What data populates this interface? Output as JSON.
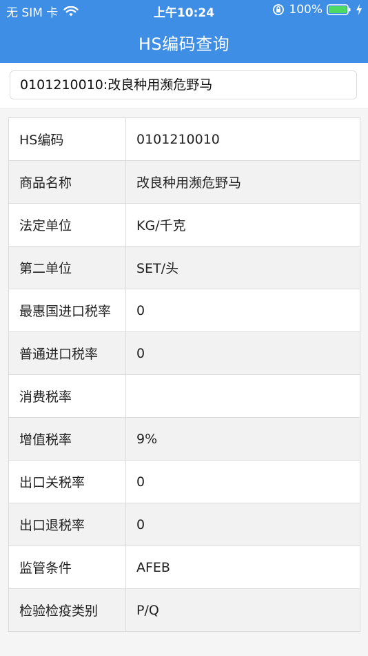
{
  "status_bar": {
    "carrier": "无 SIM 卡",
    "time": "上午10:24",
    "battery": "100%"
  },
  "header": {
    "title": "HS编码查询"
  },
  "search": {
    "value": "0101210010:改良种用濒危野马"
  },
  "table": {
    "rows": [
      {
        "label": "HS编码",
        "value": "0101210010"
      },
      {
        "label": "商品名称",
        "value": "改良种用濒危野马"
      },
      {
        "label": "法定单位",
        "value": "KG/千克"
      },
      {
        "label": "第二单位",
        "value": "SET/头"
      },
      {
        "label": "最惠国进口税率",
        "value": "0"
      },
      {
        "label": "普通进口税率",
        "value": "0"
      },
      {
        "label": "消费税率",
        "value": ""
      },
      {
        "label": "增值税率",
        "value": "9%"
      },
      {
        "label": "出口关税率",
        "value": "0"
      },
      {
        "label": "出口退税率",
        "value": "0"
      },
      {
        "label": "监管条件",
        "value": "AFEB"
      },
      {
        "label": "检验检疫类别",
        "value": "P/Q"
      }
    ]
  },
  "colors": {
    "header_bg": "#3f8ee6",
    "row_alt_bg": "#f2f2f2",
    "border": "#dcdcdc"
  }
}
